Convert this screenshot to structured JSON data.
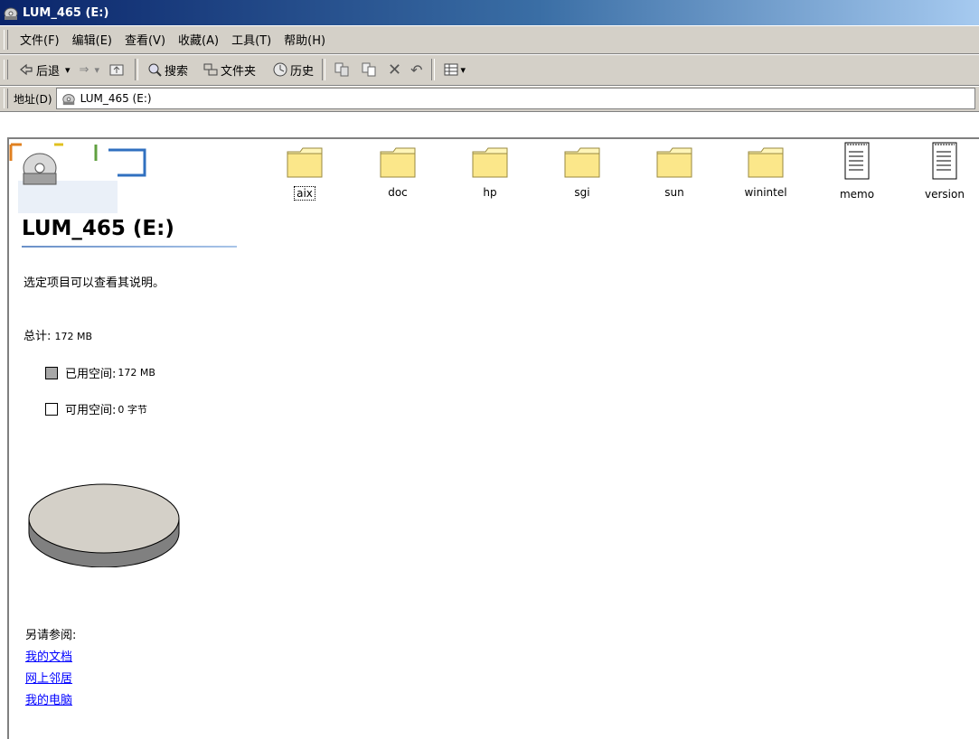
{
  "window": {
    "title": "LUM_465 (E:)"
  },
  "menu": [
    "文件(F)",
    "编辑(E)",
    "查看(V)",
    "收藏(A)",
    "工具(T)",
    "帮助(H)"
  ],
  "toolbar": {
    "back": "后退",
    "search": "搜索",
    "folders": "文件夹",
    "history": "历史"
  },
  "address": {
    "label": "地址(D)",
    "value": "LUM_465 (E:)"
  },
  "left_pane": {
    "drive_title": "LUM_465 (E:)",
    "hint": "选定项目可以查看其说明。",
    "total_label": "总计:",
    "total_value": "172 MB",
    "used_label": "已用空间:",
    "used_value": "172 MB",
    "free_label": "可用空间:",
    "free_value": "0 字节",
    "used_color": "#a8a8a8",
    "free_color": "#ffffff",
    "used_fraction": 1.0,
    "see_also_label": "另请参阅:",
    "links": [
      "我的文档",
      "网上邻居",
      "我的电脑"
    ]
  },
  "files": [
    {
      "name": "aix",
      "icon": "folder-icon"
    },
    {
      "name": "doc",
      "icon": "folder-icon"
    },
    {
      "name": "hp",
      "icon": "folder-icon"
    },
    {
      "name": "sgi",
      "icon": "folder-icon"
    },
    {
      "name": "sun",
      "icon": "folder-icon"
    },
    {
      "name": "winintel",
      "icon": "folder-icon"
    },
    {
      "name": "memo",
      "icon": "text-document-icon"
    },
    {
      "name": "version",
      "icon": "text-document-icon"
    }
  ]
}
